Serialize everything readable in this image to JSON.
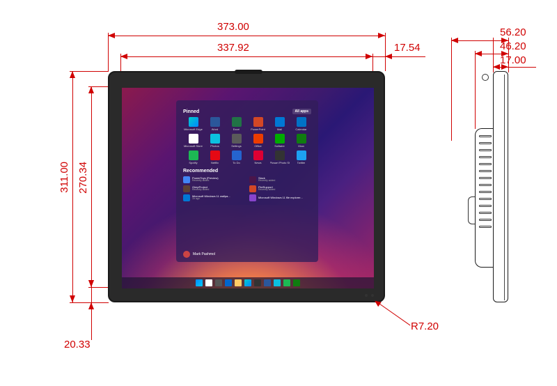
{
  "dimensions": {
    "overall_width": "373.00",
    "display_width": "337.92",
    "bezel_side": "17.54",
    "overall_height": "311.00",
    "display_height": "270.34",
    "bezel_bottom": "20.33",
    "corner_radius": "R7.20",
    "depth_total": "56.20",
    "depth_mid": "46.20",
    "depth_face": "17.00"
  },
  "start_menu": {
    "pinned_title": "Pinned",
    "all_apps": "All apps",
    "recommended_title": "Recommended",
    "user_name": "Mark Pashmol",
    "apps": [
      {
        "label": "Microsoft Edge",
        "cls": "c-edge"
      },
      {
        "label": "Word",
        "cls": "c-word"
      },
      {
        "label": "Excel",
        "cls": "c-excel"
      },
      {
        "label": "PowerPoint",
        "cls": "c-ppt"
      },
      {
        "label": "Mail",
        "cls": "c-mail"
      },
      {
        "label": "Calendar",
        "cls": "c-cal"
      },
      {
        "label": "Microsoft Store",
        "cls": "c-store"
      },
      {
        "label": "Photos",
        "cls": "c-photos"
      },
      {
        "label": "Settings",
        "cls": "c-set"
      },
      {
        "label": "Office",
        "cls": "c-off"
      },
      {
        "label": "Solitaire",
        "cls": "c-sol"
      },
      {
        "label": "Xbox",
        "cls": "c-xbox"
      },
      {
        "label": "Spotify",
        "cls": "c-spot"
      },
      {
        "label": "Netflix",
        "cls": "c-nfx"
      },
      {
        "label": "To Do",
        "cls": "c-todo"
      },
      {
        "label": "News",
        "cls": "c-news"
      },
      {
        "label": "Picsart Photo Studio Collage",
        "cls": "c-pp"
      },
      {
        "label": "Twitter",
        "cls": "c-tw"
      }
    ],
    "recommended": [
      {
        "title": "PowerToys (Preview)",
        "sub": "Recently added",
        "cls": "c-pt"
      },
      {
        "title": "Slack",
        "sub": "Recently added",
        "cls": "c-slack"
      },
      {
        "title": "GimpProject",
        "sub": "Recently added",
        "cls": "c-gimp"
      },
      {
        "title": "PictSupport",
        "sub": "Recently added",
        "cls": "c-ps"
      },
      {
        "title": "Microsoft Windows 11 wallpa...",
        "sub": "1h ago",
        "cls": "c-win"
      },
      {
        "title": "Microsoft Windows 11 file explorer...",
        "sub": "",
        "cls": "c-film"
      }
    ]
  }
}
